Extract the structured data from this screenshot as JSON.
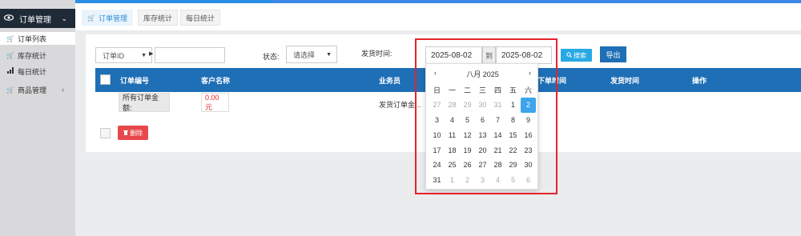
{
  "sidebar": {
    "header": {
      "label": "订单管理",
      "icon": "eye-icon"
    },
    "items": [
      {
        "label": "订单列表",
        "icon": "cart-icon"
      },
      {
        "label": "库存统计",
        "icon": "cart-icon"
      },
      {
        "label": "每日统计",
        "icon": "bar-chart-icon"
      },
      {
        "label": "商品管理",
        "icon": "cart-icon"
      }
    ]
  },
  "tabs": [
    {
      "label": "订单管理",
      "icon": "cart-icon"
    },
    {
      "label": "库存统计"
    },
    {
      "label": "每日统计"
    }
  ],
  "filters": {
    "field_select": "订单ID",
    "search_value": "",
    "status_label": "状态:",
    "status_select": "请选择",
    "ship_time_label": "发货时间:",
    "date_from": "2025-08-02",
    "to_label": "到",
    "date_to": "2025-08-02",
    "search_button": "搜索",
    "export_button": "导出"
  },
  "table": {
    "headers": [
      "订单编号",
      "客户名称",
      "业务员",
      "下单时间",
      "发货时间",
      "操作"
    ],
    "summary_label": "所有订单金额:",
    "summary_amount": "0.00元",
    "summary_note": "发货订单金...",
    "delete_button": "删除"
  },
  "datepicker": {
    "prev": "‹",
    "next": "›",
    "title": "八月 2025",
    "weekdays": [
      "日",
      "一",
      "二",
      "三",
      "四",
      "五",
      "六"
    ],
    "weeks": [
      [
        "27",
        "28",
        "29",
        "30",
        "31",
        "1",
        "2"
      ],
      [
        "3",
        "4",
        "5",
        "6",
        "7",
        "8",
        "9"
      ],
      [
        "10",
        "11",
        "12",
        "13",
        "14",
        "15",
        "16"
      ],
      [
        "17",
        "18",
        "19",
        "20",
        "21",
        "22",
        "23"
      ],
      [
        "24",
        "25",
        "26",
        "27",
        "28",
        "29",
        "30"
      ],
      [
        "31",
        "1",
        "2",
        "3",
        "4",
        "5",
        "6"
      ]
    ],
    "selected_day": "2"
  },
  "colors": {
    "accent": "#1e6fb5",
    "search": "#29a9e4",
    "danger": "#e8484c",
    "highlight_box": "#e5232a"
  }
}
